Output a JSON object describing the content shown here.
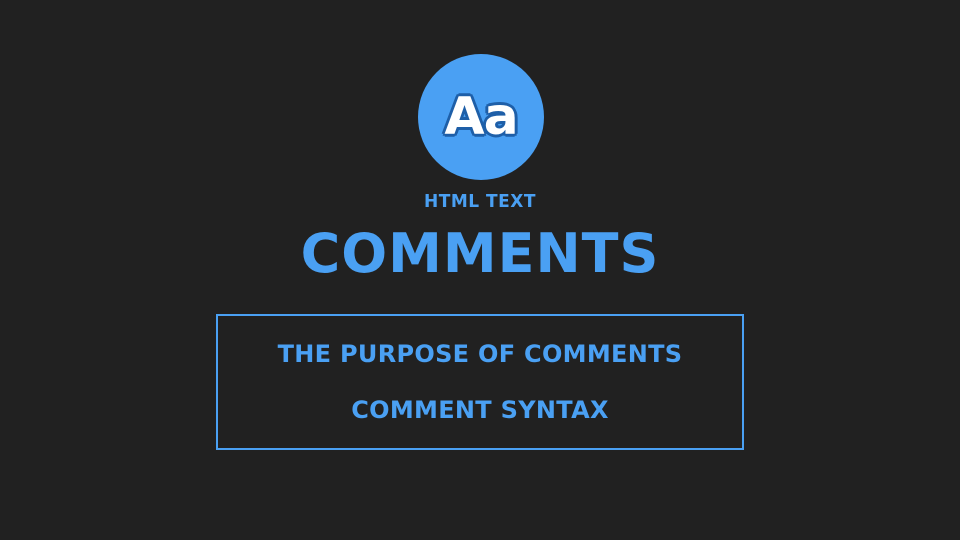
{
  "logo": {
    "text": "Aa",
    "icon": "font-icon",
    "color": "#4aa0f3"
  },
  "header": {
    "subtitle": "HTML TEXT",
    "title": "COMMENTS"
  },
  "topics": {
    "items": [
      {
        "label": "THE PURPOSE OF COMMENTS"
      },
      {
        "label": "COMMENT SYNTAX"
      }
    ]
  },
  "colors": {
    "background": "#212121",
    "accent": "#4aa0f3"
  }
}
